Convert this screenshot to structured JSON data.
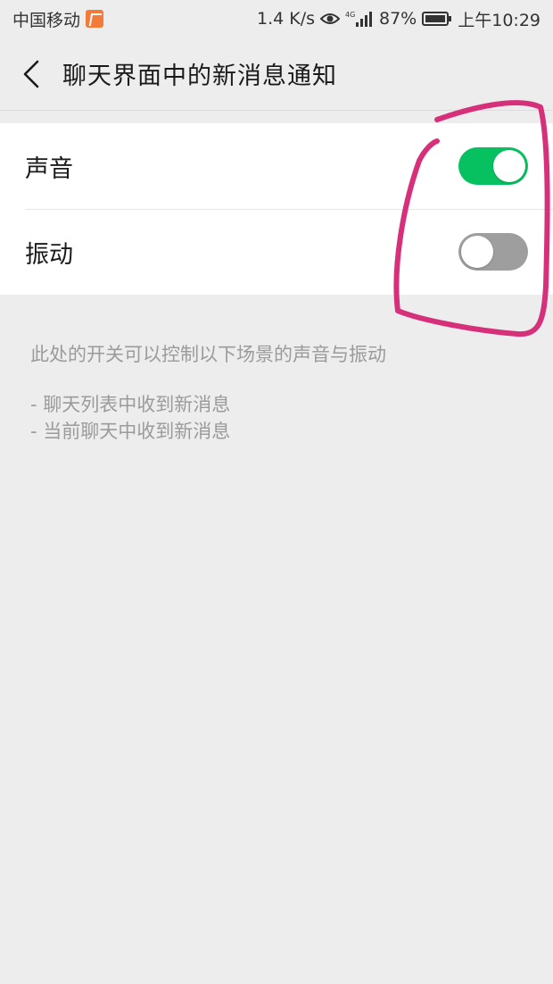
{
  "status_bar": {
    "carrier": "中国移动",
    "speed": "1.4 K/s",
    "network": "4G",
    "battery": "87%",
    "time": "上午10:29"
  },
  "header": {
    "title": "聊天界面中的新消息通知"
  },
  "settings": [
    {
      "label": "声音",
      "enabled": true
    },
    {
      "label": "振动",
      "enabled": false
    }
  ],
  "description": {
    "intro": "此处的开关可以控制以下场景的声音与振动",
    "items": [
      "- 聊天列表中收到新消息",
      "- 当前聊天中收到新消息"
    ]
  },
  "colors": {
    "toggle_on": "#07c160",
    "toggle_off": "#9e9e9e",
    "annotation": "#d6307a"
  }
}
